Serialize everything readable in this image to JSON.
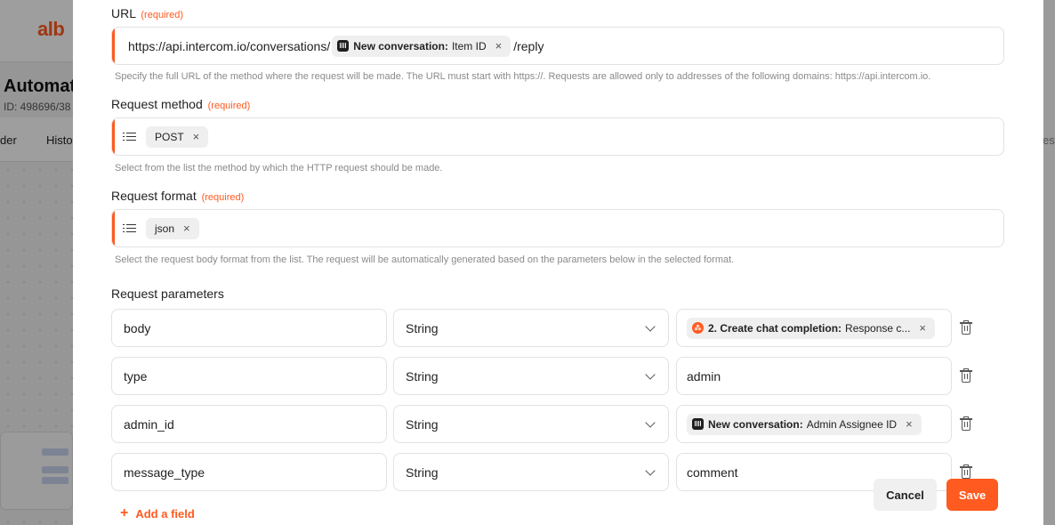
{
  "background": {
    "logo": "alb",
    "title": "Automati",
    "id_text": "ID: 498696/38",
    "tabs": [
      "der",
      "Histo"
    ],
    "right_tab": "est"
  },
  "url_field": {
    "label": "URL",
    "required": "(required)",
    "prefix": "https://api.intercom.io/conversations/",
    "chip_source": "New conversation:",
    "chip_value": "Item ID",
    "suffix": "/reply",
    "help": "Specify the full URL of the method where the request will be made. The URL must start with https://. Requests are allowed only to addresses of the following domains: https://api.intercom.io."
  },
  "method_field": {
    "label": "Request method",
    "required": "(required)",
    "value": "POST",
    "help": "Select from the list the method by which the HTTP request should be made."
  },
  "format_field": {
    "label": "Request format",
    "required": "(required)",
    "value": "json",
    "help": "Select the request body format from the list. The request will be automatically generated based on the parameters below in the selected format."
  },
  "params": {
    "label": "Request parameters",
    "rows": [
      {
        "key": "body",
        "type": "String",
        "value_kind": "chip",
        "chip_icon": "openai",
        "chip_source": "2. Create chat completion:",
        "chip_value": "Response c..."
      },
      {
        "key": "type",
        "type": "String",
        "value_kind": "text",
        "value": "admin"
      },
      {
        "key": "admin_id",
        "type": "String",
        "value_kind": "chip",
        "chip_icon": "intercom",
        "chip_source": "New conversation:",
        "chip_value": "Admin Assignee ID"
      },
      {
        "key": "message_type",
        "type": "String",
        "value_kind": "text",
        "value": "comment"
      }
    ],
    "add_label": "Add a field"
  },
  "close_glyph": "×",
  "buttons": {
    "cancel": "Cancel",
    "save": "Save"
  },
  "colors": {
    "accent": "#ff5a1f",
    "border": "#e2e2e2",
    "help": "#8a8a8a"
  }
}
